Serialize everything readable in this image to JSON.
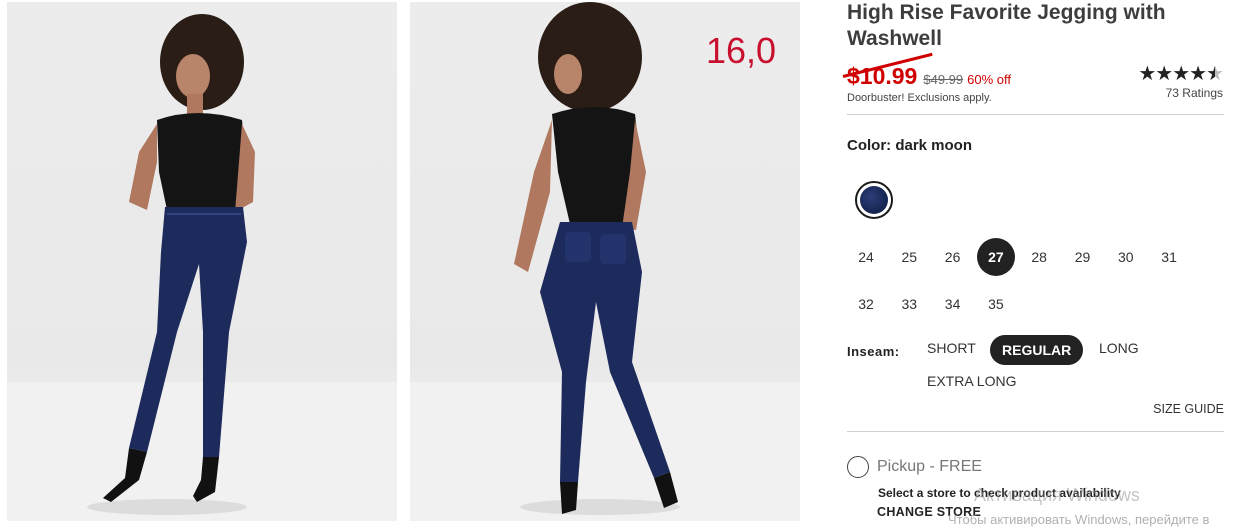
{
  "product": {
    "title_line1": "High Rise Favorite Jegging with",
    "title_line2": "Washwell",
    "sale_price": "$10.99",
    "original_price": "$49.99",
    "percent_off": "60% off",
    "promo_note": "Doorbuster! Exclusions apply.",
    "rating_value": 4.5,
    "rating_max": 5,
    "rating_count": "73 Ratings"
  },
  "photos": {
    "overlay_note": "16,0"
  },
  "color": {
    "label": "Color: dark moon",
    "swatch_hex": "#1c2a5c"
  },
  "sizes": {
    "row1": [
      "24",
      "25",
      "26",
      "27",
      "28",
      "29",
      "30",
      "31"
    ],
    "row2": [
      "32",
      "33",
      "34",
      "35"
    ],
    "selected": "27"
  },
  "inseam": {
    "label": "Inseam:",
    "options": [
      "SHORT",
      "REGULAR",
      "LONG",
      "EXTRA LONG"
    ],
    "selected": "REGULAR"
  },
  "size_guide": "SIZE GUIDE",
  "pickup": {
    "label": "Pickup - FREE",
    "store_note": "Select a store to check product availability",
    "change_store": "CHANGE STORE"
  },
  "os_watermark": {
    "line1": "Активация Windows",
    "line2": "Чтобы активировать Windows, перейдите в"
  },
  "colors": {
    "sale_red": "#d00000",
    "selected_dark": "#222222",
    "denim": "#1c2a5c"
  }
}
